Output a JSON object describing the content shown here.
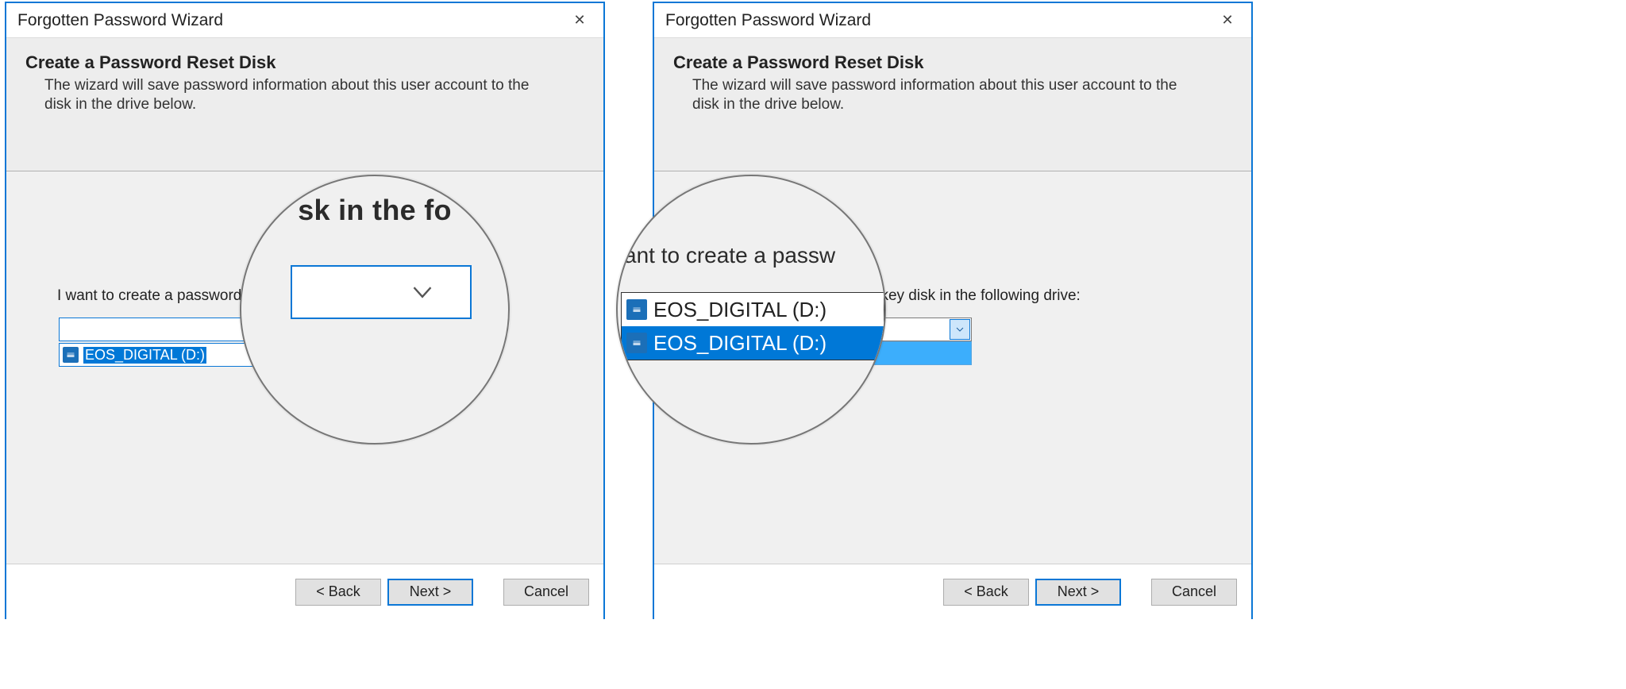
{
  "window_title": "Forgotten Password Wizard",
  "header": {
    "title": "Create a Password Reset Disk",
    "desc": "The wizard will save password information about this user account to the disk in the drive below."
  },
  "body": {
    "prompt": "I want to create a password key disk in the following drive:",
    "selected": "EOS_DIGITAL (D:)",
    "options": [
      "EOS_DIGITAL (D:)",
      "EOS_DIGITAL (D:)"
    ]
  },
  "buttons": {
    "back": "< Back",
    "next": "Next >",
    "cancel": "Cancel"
  },
  "lens_right": {
    "prompt_fragment": "ant to create a passw",
    "opt0": "EOS_DIGITAL (D:)",
    "opt1": "EOS_DIGITAL (D:)"
  },
  "lens_left": {
    "heading_fragment": "sk in the fo"
  },
  "right_body_fragments": {
    "prompt_tail": "ssword key disk in the following drive:",
    "combo_val_tail": "D:)",
    "dd_tail": "D:)"
  }
}
